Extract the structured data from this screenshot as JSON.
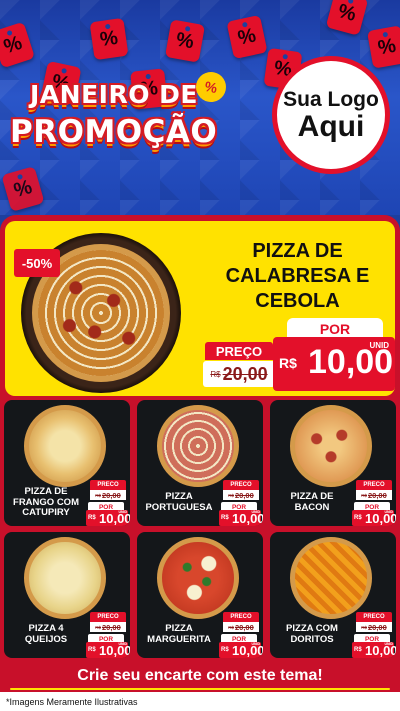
{
  "header": {
    "tags": [
      "%",
      "%",
      "%",
      "%",
      "%",
      "%",
      "%",
      "%",
      "%",
      "%"
    ],
    "title_line1": "JANEIRO DE",
    "title_line2": "PROMOÇÃO",
    "burst": "%",
    "logo_line1": "Sua Logo",
    "logo_line2": "Aqui"
  },
  "featured": {
    "discount": "-50%",
    "name": "PIZZA DE CALABRESA E CEBOLA",
    "preco_label": "PREÇO",
    "old_currency": "R$",
    "old_price": "20,00",
    "por_label": "POR",
    "new_currency": "R$",
    "new_price": "10,00",
    "unit": "UNID"
  },
  "products": [
    {
      "name": "PIZZA DE FRANGO COM CATUPIRY",
      "preco_label": "PRECO",
      "old_currency": "R$",
      "old_price": "20,00",
      "por_label": "POR",
      "new_currency": "R$",
      "new_price": "10,00",
      "unit": "UNID",
      "image": "pizza-frango-catupiry"
    },
    {
      "name": "PIZZA PORTUGUESA",
      "preco_label": "PRECO",
      "old_currency": "R$",
      "old_price": "20,00",
      "por_label": "POR",
      "new_currency": "R$",
      "new_price": "10,00",
      "unit": "UNID",
      "image": "pizza-portuguesa"
    },
    {
      "name": "PIZZA DE BACON",
      "preco_label": "PRECO",
      "old_currency": "R$",
      "old_price": "20,00",
      "por_label": "POR",
      "new_currency": "R$",
      "new_price": "10,00",
      "unit": "UNID",
      "image": "pizza-bacon"
    },
    {
      "name": "PIZZA 4 QUEIJOS",
      "preco_label": "PRECO",
      "old_currency": "R$",
      "old_price": "20,00",
      "por_label": "POR",
      "new_currency": "R$",
      "new_price": "10,00",
      "unit": "UNID",
      "image": "pizza-4-queijos"
    },
    {
      "name": "PIZZA MARGUERITA",
      "preco_label": "PRECO",
      "old_currency": "R$",
      "old_price": "20,00",
      "por_label": "POR",
      "new_currency": "R$",
      "new_price": "10,00",
      "unit": "UNID",
      "image": "pizza-marguerita"
    },
    {
      "name": "PIZZA COM DORITOS",
      "preco_label": "PRECO",
      "old_currency": "R$",
      "old_price": "20,00",
      "por_label": "POR",
      "new_currency": "R$",
      "new_price": "10,00",
      "unit": "UNID",
      "image": "pizza-doritos"
    }
  ],
  "cta": "Crie seu encarte com este tema!",
  "footer": "*Imagens Meramente Ilustrativas",
  "colors": {
    "brand_red": "#e3102a",
    "panel_red": "#c8102a",
    "highlight_yellow": "#ffe200",
    "header_blue": "#1d3f9e",
    "card_dark": "#14171a"
  }
}
